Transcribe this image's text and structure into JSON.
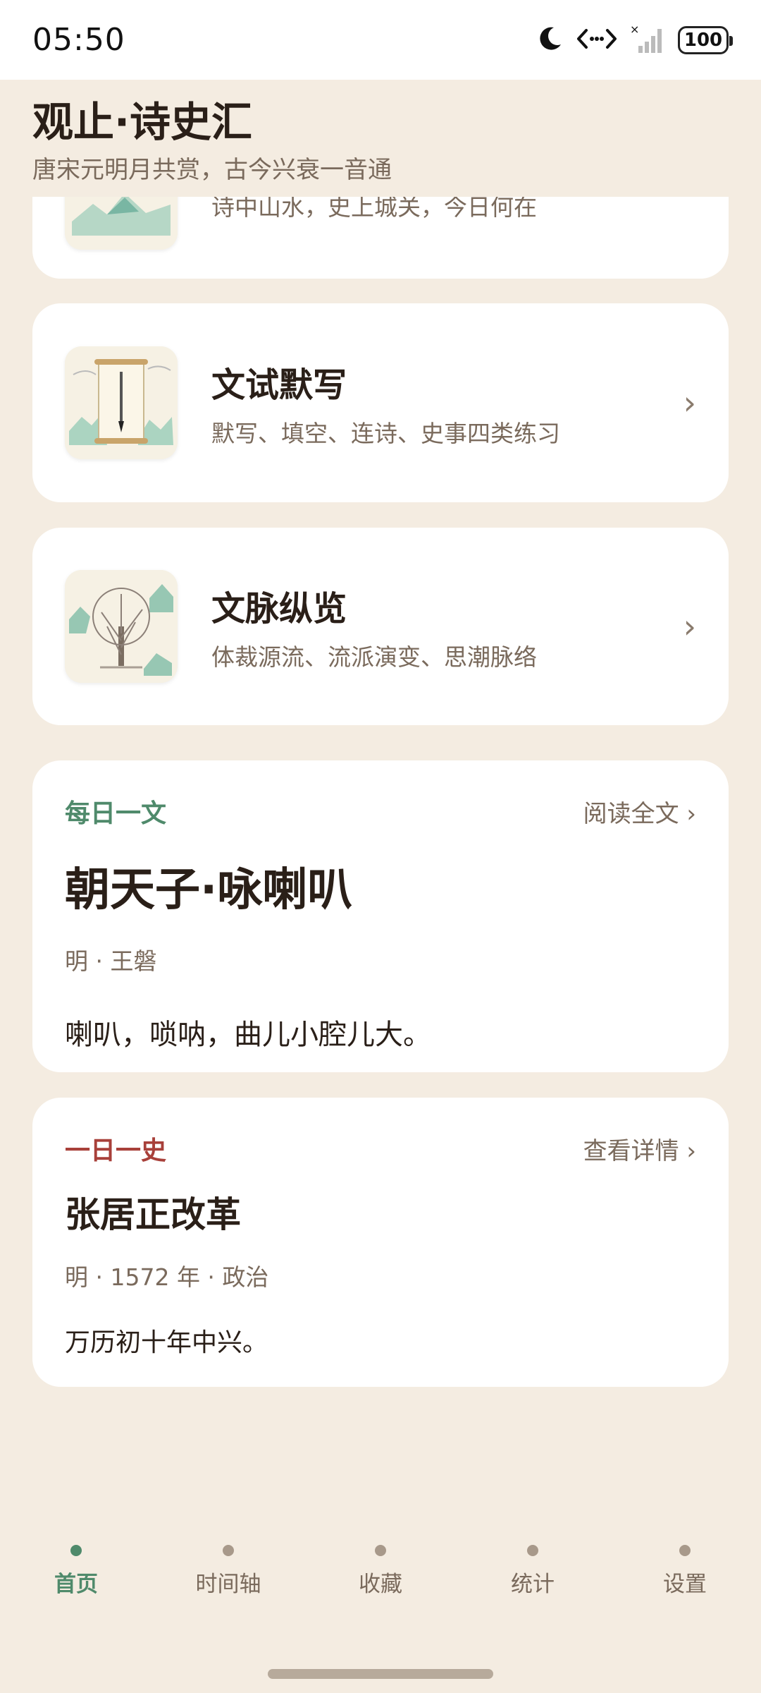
{
  "status_bar": {
    "time": "05:50",
    "battery": "100",
    "icons": [
      "moon-icon",
      "data-transfer-icon",
      "signal-icon",
      "battery-icon"
    ]
  },
  "header": {
    "title": "观止·诗史汇",
    "subtitle": "唐宋元明月共赏，古今兴衰一音通"
  },
  "feature_cards": [
    {
      "title": "",
      "desc": "诗中山水，史上城关，今日何在",
      "icon": "landscape-thumb"
    },
    {
      "title": "文试默写",
      "desc": "默写、填空、连诗、史事四类练习",
      "icon": "scroll-brush-thumb"
    },
    {
      "title": "文脉纵览",
      "desc": "体裁源流、流派演变、思潮脉络",
      "icon": "tree-thumb"
    }
  ],
  "daily_poem": {
    "tag": "每日一文",
    "link": "阅读全文 ›",
    "title": "朝天子·咏喇叭",
    "meta": "明 · 王磐",
    "excerpt": "喇叭，唢呐，曲儿小腔儿大。"
  },
  "daily_history": {
    "tag": "一日一史",
    "link": "查看详情 ›",
    "title": "张居正改革",
    "meta": "明 · 1572 年 · 政治",
    "excerpt": "万历初十年中兴。"
  },
  "chevron": "›",
  "bottom_nav": [
    {
      "label": "首页",
      "active": true
    },
    {
      "label": "时间轴",
      "active": false
    },
    {
      "label": "收藏",
      "active": false
    },
    {
      "label": "统计",
      "active": false
    },
    {
      "label": "设置",
      "active": false
    }
  ],
  "colors": {
    "background": "#f4ece1",
    "accent_green": "#4f8a6b",
    "accent_red": "#a8403a",
    "text_dark": "#2a1f18",
    "text_muted": "#7a6a5c"
  }
}
